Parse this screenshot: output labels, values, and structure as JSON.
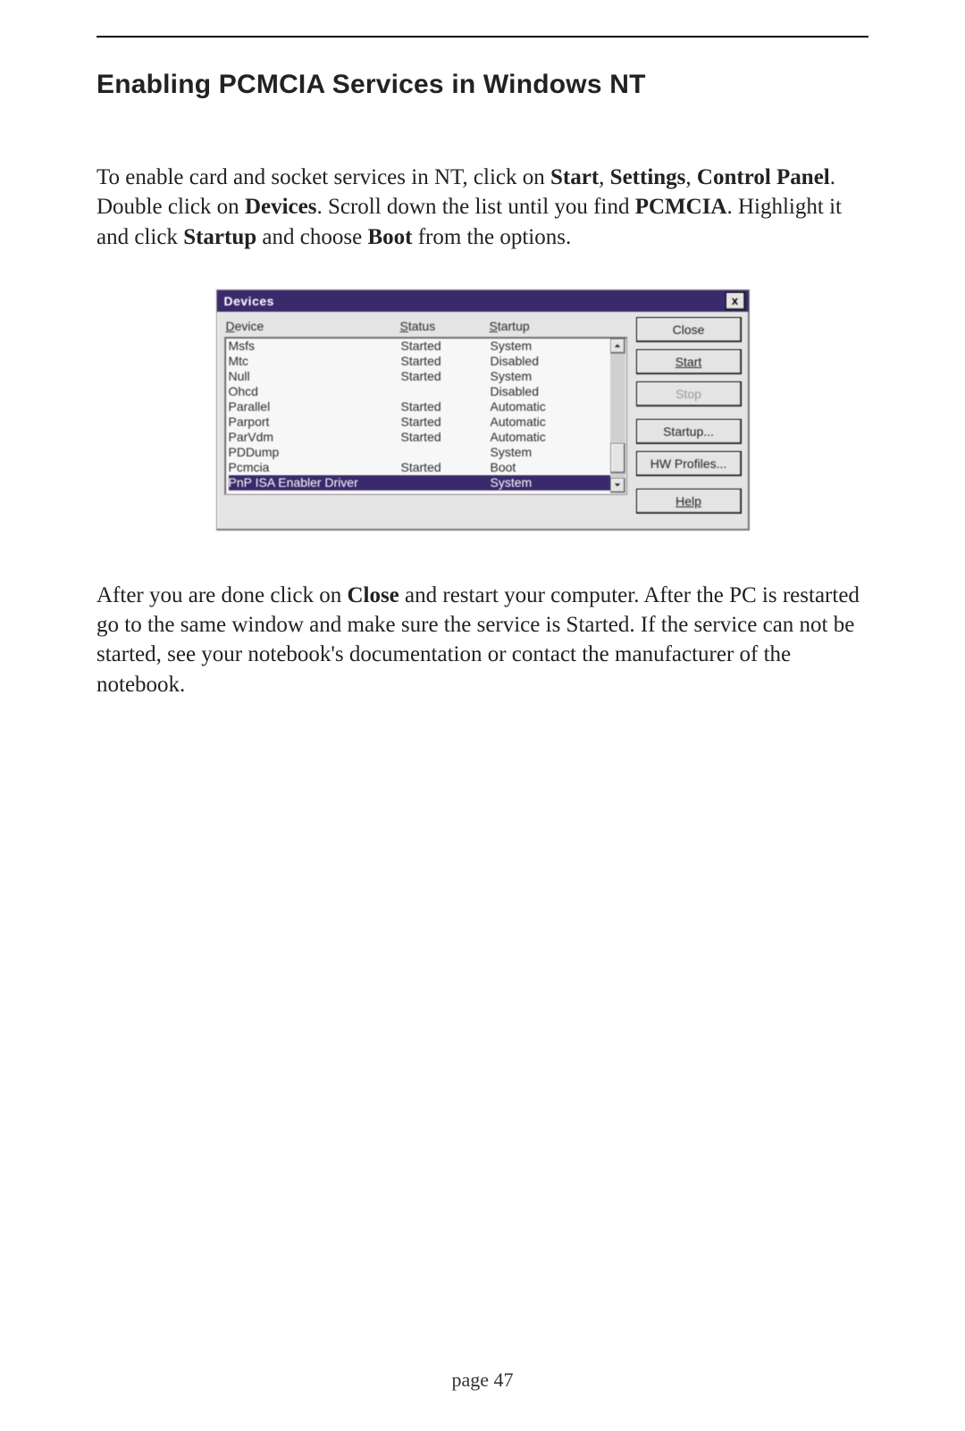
{
  "page": {
    "title": "Enabling PCMCIA Services in Windows NT",
    "footer": "page 47"
  },
  "para1": {
    "t1": "To enable card and socket services in NT, click on ",
    "b1": "Start",
    "c1": ", ",
    "b2": "Settings",
    "c2": ", ",
    "b3": "Control Panel",
    "t2": ". Double click on ",
    "b4": "Devices",
    "t3": ". Scroll down the list until you find ",
    "b5": "PCMCIA",
    "t4": ". Highlight it and click ",
    "b6": "Startup",
    "t5": " and choose ",
    "b7": "Boot",
    "t6": " from the options."
  },
  "para2": {
    "t1": "After you are done click on ",
    "b1": "Close",
    "t2": " and restart your computer. After the PC is restarted go to the same window and make sure the service is Started. If the service can not be started, see your notebook's documentation or contact the manufacturer of the notebook."
  },
  "dialog": {
    "title": "Devices",
    "close_x": "x",
    "headers": {
      "device": "Device",
      "status": "Status",
      "startup": "Startup"
    },
    "rows": [
      {
        "device": "Msfs",
        "status": "Started",
        "startup": "System"
      },
      {
        "device": "Mtc",
        "status": "Started",
        "startup": "Disabled"
      },
      {
        "device": "Null",
        "status": "Started",
        "startup": "System"
      },
      {
        "device": "Ohcd",
        "status": "",
        "startup": "Disabled"
      },
      {
        "device": "Parallel",
        "status": "Started",
        "startup": "Automatic"
      },
      {
        "device": "Parport",
        "status": "Started",
        "startup": "Automatic"
      },
      {
        "device": "ParVdm",
        "status": "Started",
        "startup": "Automatic"
      },
      {
        "device": "PDDump",
        "status": "",
        "startup": "System"
      },
      {
        "device": "Pcmcia",
        "status": "Started",
        "startup": "Boot"
      },
      {
        "device": "PnP ISA Enabler Driver",
        "status": "",
        "startup": "System"
      }
    ],
    "selected_index": 9,
    "buttons": {
      "close": "Close",
      "start": "Start",
      "stop": "Stop",
      "startup": "Startup...",
      "hw": "HW Profiles...",
      "help": "Help"
    }
  }
}
